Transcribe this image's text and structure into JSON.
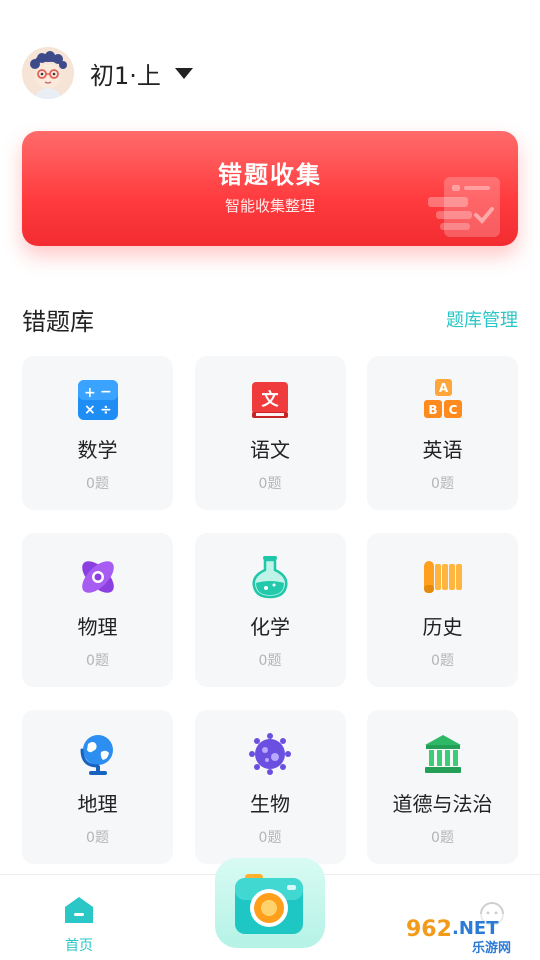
{
  "header": {
    "grade_label": "初1·上"
  },
  "banner": {
    "title": "错题收集",
    "subtitle": "智能收集整理"
  },
  "section": {
    "title": "错题库",
    "manage_link": "题库管理"
  },
  "subjects": [
    {
      "name": "数学",
      "count": "0题",
      "icon": "math-icon"
    },
    {
      "name": "语文",
      "count": "0题",
      "icon": "chinese-book-icon"
    },
    {
      "name": "英语",
      "count": "0题",
      "icon": "abc-blocks-icon"
    },
    {
      "name": "物理",
      "count": "0题",
      "icon": "atom-icon"
    },
    {
      "name": "化学",
      "count": "0题",
      "icon": "flask-icon"
    },
    {
      "name": "历史",
      "count": "0题",
      "icon": "scroll-icon"
    },
    {
      "name": "地理",
      "count": "0题",
      "icon": "globe-icon"
    },
    {
      "name": "生物",
      "count": "0题",
      "icon": "cell-icon"
    },
    {
      "name": "道德与法治",
      "count": "0题",
      "icon": "courthouse-icon"
    }
  ],
  "tabbar": {
    "home_label": "首页"
  },
  "watermark": {
    "text_top": "962.NET",
    "text_bottom": "乐游网"
  },
  "colors": {
    "accent": "#2bc6c6",
    "banner_red": "#ff3b3e",
    "card_bg": "#f6f7f9"
  }
}
